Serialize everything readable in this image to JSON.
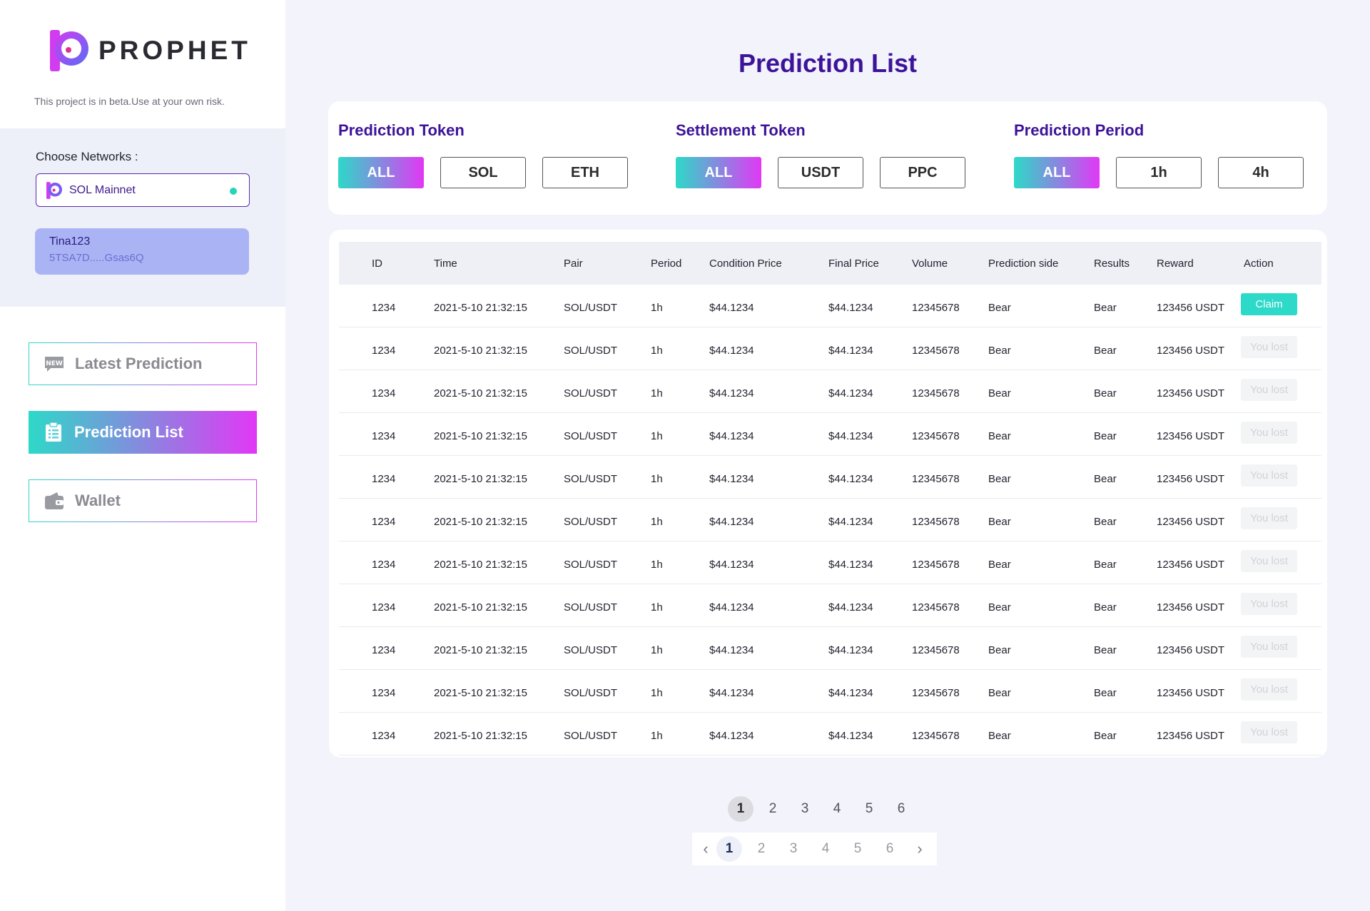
{
  "sidebar": {
    "logo_text": "PROPHET",
    "beta_notice": "This project is in beta.Use at your own risk.",
    "network_label": "Choose Networks :",
    "network_selected": "SOL Mainnet",
    "account_name": "Tina123",
    "account_address": "5TSA7D.....Gsas6Q",
    "nav": [
      {
        "label": "Latest Prediction",
        "icon": "new-badge-icon",
        "active": false
      },
      {
        "label": "Prediction List",
        "icon": "clipboard-list-icon",
        "active": true
      },
      {
        "label": "Wallet",
        "icon": "wallet-icon",
        "active": false
      }
    ]
  },
  "page_title": "Prediction List",
  "filters": {
    "prediction_token": {
      "title": "Prediction Token",
      "options": [
        "ALL",
        "SOL",
        "ETH"
      ],
      "selected": "ALL"
    },
    "settlement_token": {
      "title": "Settlement Token",
      "options": [
        "ALL",
        "USDT",
        "PPC"
      ],
      "selected": "ALL"
    },
    "prediction_period": {
      "title": "Prediction Period",
      "options": [
        "ALL",
        "1h",
        "4h"
      ],
      "selected": "ALL"
    }
  },
  "table": {
    "headers": [
      "ID",
      "Time",
      "Pair",
      "Period",
      "Condition Price",
      "Final Price",
      "Volume",
      "Prediction side",
      "Results",
      "Reward",
      "Action"
    ],
    "rows": [
      {
        "id": "1234",
        "time": "2021-5-10 21:32:15",
        "pair": "SOL/USDT",
        "period": "1h",
        "condition_price": "$44.1234",
        "final_price": "$44.1234",
        "volume": "12345678",
        "side": "Bear",
        "result": "Bear",
        "reward": "123456 USDT",
        "action": "Claim",
        "action_type": "claim"
      },
      {
        "id": "1234",
        "time": "2021-5-10 21:32:15",
        "pair": "SOL/USDT",
        "period": "1h",
        "condition_price": "$44.1234",
        "final_price": "$44.1234",
        "volume": "12345678",
        "side": "Bear",
        "result": "Bear",
        "reward": "123456 USDT",
        "action": "You lost",
        "action_type": "lost"
      },
      {
        "id": "1234",
        "time": "2021-5-10 21:32:15",
        "pair": "SOL/USDT",
        "period": "1h",
        "condition_price": "$44.1234",
        "final_price": "$44.1234",
        "volume": "12345678",
        "side": "Bear",
        "result": "Bear",
        "reward": "123456 USDT",
        "action": "You lost",
        "action_type": "lost"
      },
      {
        "id": "1234",
        "time": "2021-5-10 21:32:15",
        "pair": "SOL/USDT",
        "period": "1h",
        "condition_price": "$44.1234",
        "final_price": "$44.1234",
        "volume": "12345678",
        "side": "Bear",
        "result": "Bear",
        "reward": "123456 USDT",
        "action": "You lost",
        "action_type": "lost"
      },
      {
        "id": "1234",
        "time": "2021-5-10 21:32:15",
        "pair": "SOL/USDT",
        "period": "1h",
        "condition_price": "$44.1234",
        "final_price": "$44.1234",
        "volume": "12345678",
        "side": "Bear",
        "result": "Bear",
        "reward": "123456 USDT",
        "action": "You lost",
        "action_type": "lost"
      },
      {
        "id": "1234",
        "time": "2021-5-10 21:32:15",
        "pair": "SOL/USDT",
        "period": "1h",
        "condition_price": "$44.1234",
        "final_price": "$44.1234",
        "volume": "12345678",
        "side": "Bear",
        "result": "Bear",
        "reward": "123456 USDT",
        "action": "You lost",
        "action_type": "lost"
      },
      {
        "id": "1234",
        "time": "2021-5-10 21:32:15",
        "pair": "SOL/USDT",
        "period": "1h",
        "condition_price": "$44.1234",
        "final_price": "$44.1234",
        "volume": "12345678",
        "side": "Bear",
        "result": "Bear",
        "reward": "123456 USDT",
        "action": "You lost",
        "action_type": "lost"
      },
      {
        "id": "1234",
        "time": "2021-5-10 21:32:15",
        "pair": "SOL/USDT",
        "period": "1h",
        "condition_price": "$44.1234",
        "final_price": "$44.1234",
        "volume": "12345678",
        "side": "Bear",
        "result": "Bear",
        "reward": "123456 USDT",
        "action": "You lost",
        "action_type": "lost"
      },
      {
        "id": "1234",
        "time": "2021-5-10 21:32:15",
        "pair": "SOL/USDT",
        "period": "1h",
        "condition_price": "$44.1234",
        "final_price": "$44.1234",
        "volume": "12345678",
        "side": "Bear",
        "result": "Bear",
        "reward": "123456 USDT",
        "action": "You lost",
        "action_type": "lost"
      },
      {
        "id": "1234",
        "time": "2021-5-10 21:32:15",
        "pair": "SOL/USDT",
        "period": "1h",
        "condition_price": "$44.1234",
        "final_price": "$44.1234",
        "volume": "12345678",
        "side": "Bear",
        "result": "Bear",
        "reward": "123456 USDT",
        "action": "You lost",
        "action_type": "lost"
      },
      {
        "id": "1234",
        "time": "2021-5-10 21:32:15",
        "pair": "SOL/USDT",
        "period": "1h",
        "condition_price": "$44.1234",
        "final_price": "$44.1234",
        "volume": "12345678",
        "side": "Bear",
        "result": "Bear",
        "reward": "123456 USDT",
        "action": "You lost",
        "action_type": "lost"
      }
    ]
  },
  "pagination_top": {
    "pages": [
      "1",
      "2",
      "3",
      "4",
      "5",
      "6"
    ],
    "current": "1"
  },
  "pagination_bottom": {
    "pages": [
      "1",
      "2",
      "3",
      "4",
      "5",
      "6"
    ],
    "current": "1",
    "prev_icon": "chevron-left-icon",
    "next_icon": "chevron-right-icon"
  },
  "colors": {
    "accent_purple": "#3d1399",
    "gradient_start": "#2dd9c8",
    "gradient_end": "#e138f5",
    "claim": "#2dd9c8"
  }
}
